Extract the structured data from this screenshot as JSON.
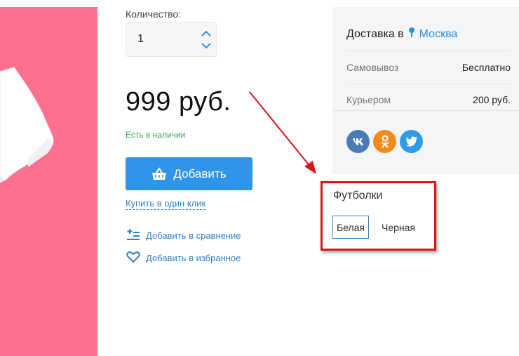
{
  "quantity": {
    "label": "Количество:",
    "value": "1"
  },
  "price": "999 руб.",
  "stock_status": "Есть в наличии",
  "add_button": {
    "label": "Добавить"
  },
  "one_click": "Купить в один клик",
  "actions": {
    "compare": "Добавить в сравнение",
    "favorite": "Добавить в избранное"
  },
  "delivery": {
    "title": "Доставка в",
    "city": "Москва",
    "rows": [
      {
        "label": "Самовывоз",
        "value": "Бесплатно"
      },
      {
        "label": "Курьером",
        "value": "200 руб."
      }
    ]
  },
  "social": [
    "vk-icon",
    "odnoklassniki-icon",
    "twitter-icon"
  ],
  "variants": {
    "title": "Футболки",
    "options": [
      "Белая",
      "Черная"
    ],
    "selected": "Белая"
  },
  "colors": {
    "accent": "#2f95e8",
    "link": "#2f7fc6",
    "in_stock": "#3aa35a",
    "image_background": "#ff6f8f",
    "annotation": "#d9161c"
  }
}
